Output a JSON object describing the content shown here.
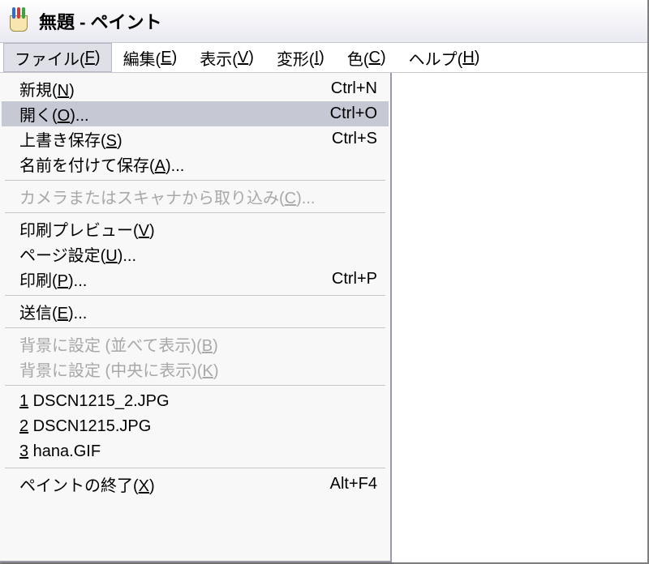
{
  "window": {
    "title": "無題 - ペイント"
  },
  "menubar": {
    "items": [
      {
        "pre": "ファイル(",
        "accel": "F",
        "post": ")"
      },
      {
        "pre": "編集(",
        "accel": "E",
        "post": ")"
      },
      {
        "pre": "表示(",
        "accel": "V",
        "post": ")"
      },
      {
        "pre": "変形(",
        "accel": "I",
        "post": ")"
      },
      {
        "pre": "色(",
        "accel": "C",
        "post": ")"
      },
      {
        "pre": "ヘルプ(",
        "accel": "H",
        "post": ")"
      }
    ],
    "active_index": 0
  },
  "file_menu": {
    "groups": [
      [
        {
          "pre": "新規(",
          "accel": "N",
          "post": ")",
          "shortcut": "Ctrl+N",
          "disabled": false,
          "highlight": false
        },
        {
          "pre": "開く(",
          "accel": "O",
          "post": ")...",
          "shortcut": "Ctrl+O",
          "disabled": false,
          "highlight": true
        },
        {
          "pre": "上書き保存(",
          "accel": "S",
          "post": ")",
          "shortcut": "Ctrl+S",
          "disabled": false,
          "highlight": false
        },
        {
          "pre": "名前を付けて保存(",
          "accel": "A",
          "post": ")...",
          "shortcut": "",
          "disabled": false,
          "highlight": false
        }
      ],
      [
        {
          "pre": "カメラまたはスキャナから取り込み(",
          "accel": "C",
          "post": ")...",
          "shortcut": "",
          "disabled": true,
          "highlight": false
        }
      ],
      [
        {
          "pre": "印刷プレビュー(",
          "accel": "V",
          "post": ")",
          "shortcut": "",
          "disabled": false,
          "highlight": false
        },
        {
          "pre": "ページ設定(",
          "accel": "U",
          "post": ")...",
          "shortcut": "",
          "disabled": false,
          "highlight": false
        },
        {
          "pre": "印刷(",
          "accel": "P",
          "post": ")...",
          "shortcut": "Ctrl+P",
          "disabled": false,
          "highlight": false
        }
      ],
      [
        {
          "pre": "送信(",
          "accel": "E",
          "post": ")...",
          "shortcut": "",
          "disabled": false,
          "highlight": false
        }
      ],
      [
        {
          "pre": "背景に設定 (並べて表示)(",
          "accel": "B",
          "post": ")",
          "shortcut": "",
          "disabled": true,
          "highlight": false
        },
        {
          "pre": "背景に設定 (中央に表示)(",
          "accel": "K",
          "post": ")",
          "shortcut": "",
          "disabled": true,
          "highlight": false
        }
      ],
      [
        {
          "pre": "",
          "accel": "1",
          "post": " DSCN1215_2.JPG",
          "shortcut": "",
          "disabled": false,
          "highlight": false
        },
        {
          "pre": "",
          "accel": "2",
          "post": " DSCN1215.JPG",
          "shortcut": "",
          "disabled": false,
          "highlight": false
        },
        {
          "pre": "",
          "accel": "3",
          "post": " hana.GIF",
          "shortcut": "",
          "disabled": false,
          "highlight": false
        }
      ],
      [
        {
          "pre": "ペイントの終了(",
          "accel": "X",
          "post": ")",
          "shortcut": "Alt+F4",
          "disabled": false,
          "highlight": false
        }
      ]
    ]
  }
}
